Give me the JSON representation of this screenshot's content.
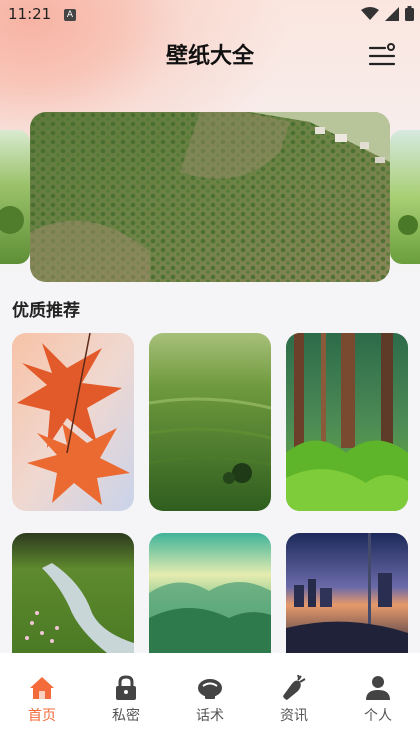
{
  "status": {
    "time": "11:21",
    "badge": "A"
  },
  "header": {
    "title": "壁纸大全"
  },
  "section": {
    "title": "优质推荐"
  },
  "nav": {
    "items": [
      {
        "label": "首页",
        "icon": "home-icon",
        "active": true
      },
      {
        "label": "私密",
        "icon": "lock-icon",
        "active": false
      },
      {
        "label": "话术",
        "icon": "chat-bowl-icon",
        "active": false
      },
      {
        "label": "资讯",
        "icon": "carrot-icon",
        "active": false
      },
      {
        "label": "个人",
        "icon": "person-icon",
        "active": false
      }
    ]
  },
  "colors": {
    "accent": "#f36b3b",
    "title": "#111111"
  }
}
